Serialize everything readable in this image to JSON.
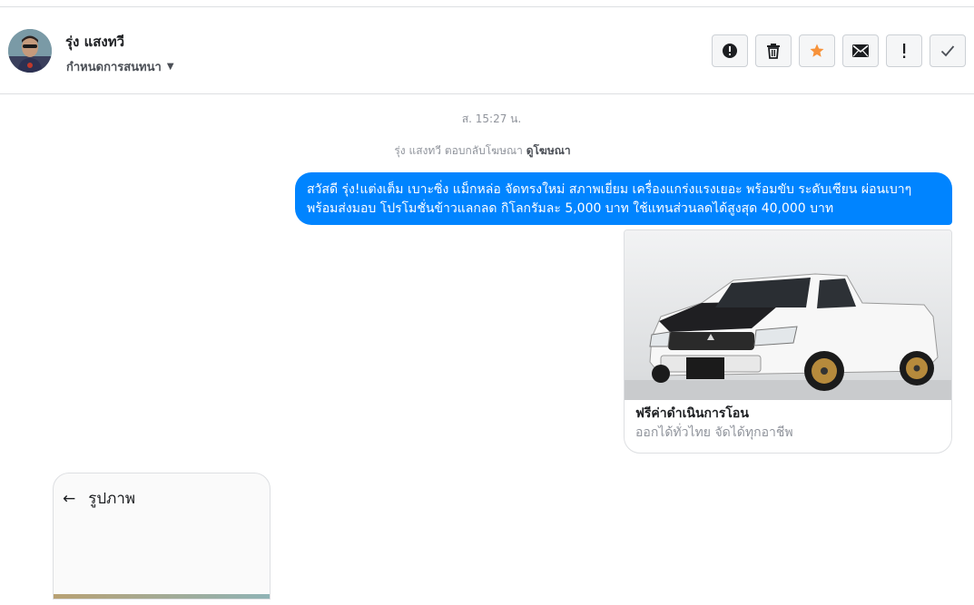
{
  "header": {
    "contact_name": "รุ่ง แสงทวี",
    "assign_label": "กำหนดการสนทนา",
    "actions": [
      {
        "name": "mark-spam-button",
        "icon": "exclamation-circle-icon"
      },
      {
        "name": "delete-button",
        "icon": "trash-icon"
      },
      {
        "name": "star-button",
        "icon": "star-icon"
      },
      {
        "name": "mark-unread-button",
        "icon": "envelope-icon"
      },
      {
        "name": "follow-up-button",
        "icon": "exclamation-icon"
      },
      {
        "name": "mark-done-button",
        "icon": "check-icon"
      }
    ]
  },
  "thread": {
    "timestamp": "ส. 15:27 น.",
    "replied_text": "รุ่ง แสงทวี ตอบกลับโฆษณา",
    "view_ad_link": "ดูโฆษณา",
    "message": "สวัสดี รุ่ง!แต่งเต็ม เบาะซิ่ง แม็กหล่อ จัดทรงใหม่ สภาพเยี่ยม เครื่องแกร่งแรงเยอะ พร้อมขับ ระดับเซียน ผ่อนเบาๆ พร้อมส่งมอบ โปรโมชั่นข้าวแลกลด กิโลกรัมละ 5,000 บาท ใช้แทนส่วนลดได้สูงสุด 40,000 บาท",
    "ad_card": {
      "title": "ฟรีค่าดำเนินการโอน",
      "subtitle": "ออกได้ทั่วไทย จัดได้ทุกอาชีพ"
    },
    "image_preview": {
      "title": "รูปภาพ"
    }
  },
  "colors": {
    "bubble": "#0084ff",
    "star": "#f7923a",
    "border": "#dddfe2"
  }
}
